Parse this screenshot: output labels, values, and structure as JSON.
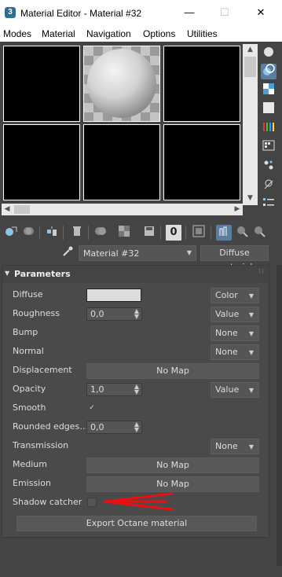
{
  "window": {
    "app_icon": "3",
    "title": "Material Editor - Material #32",
    "minimize": "—",
    "maximize": "☐",
    "close": "✕"
  },
  "menu": [
    "Modes",
    "Material",
    "Navigation",
    "Options",
    "Utilities"
  ],
  "slots": {
    "selected_index": 1,
    "count": 6
  },
  "sidebar_icons": [
    "sphere-icon",
    "backlight-icon",
    "checker-background-icon",
    "sample-uv-tiling-icon",
    "video-color-check-icon",
    "make-preview-icon",
    "options-icon",
    "select-by-material-icon",
    "material-map-navigator-icon"
  ],
  "toolbar_icons": [
    "get-material-icon",
    "put-to-scene-icon",
    "assign-to-selection-icon",
    "reset-map-icon",
    "copy-material-icon",
    "make-unique-icon",
    "put-to-library-icon",
    "material-id-channel-icon",
    "show-shaded-map-icon",
    "show-end-result-icon",
    "go-to-parent-icon",
    "go-forward-icon"
  ],
  "material_id_channel": "0",
  "material": {
    "name": "Material #32",
    "type": "Diffuse material"
  },
  "rollout": {
    "title": "Parameters",
    "fields": {
      "diffuse": {
        "label": "Diffuse",
        "color": "#dcdcdc",
        "mode": "Color"
      },
      "roughness": {
        "label": "Roughness",
        "value": "0,0",
        "mode": "Value"
      },
      "bump": {
        "label": "Bump",
        "mode": "None"
      },
      "normal": {
        "label": "Normal",
        "mode": "None"
      },
      "displacement": {
        "label": "Displacement",
        "map": "No Map"
      },
      "opacity": {
        "label": "Opacity",
        "value": "1,0",
        "mode": "Value"
      },
      "smooth": {
        "label": "Smooth",
        "checked": true,
        "check": "✓"
      },
      "rounded_edges": {
        "label": "Rounded edges…",
        "value": "0,0"
      },
      "transmission": {
        "label": "Transmission",
        "mode": "None"
      },
      "medium": {
        "label": "Medium",
        "map": "No Map"
      },
      "emission": {
        "label": "Emission",
        "map": "No Map"
      },
      "shadow_catcher": {
        "label": "Shadow catcher",
        "checked": false
      }
    },
    "export_button": "Export Octane material"
  },
  "annotation_color": "#e81010"
}
